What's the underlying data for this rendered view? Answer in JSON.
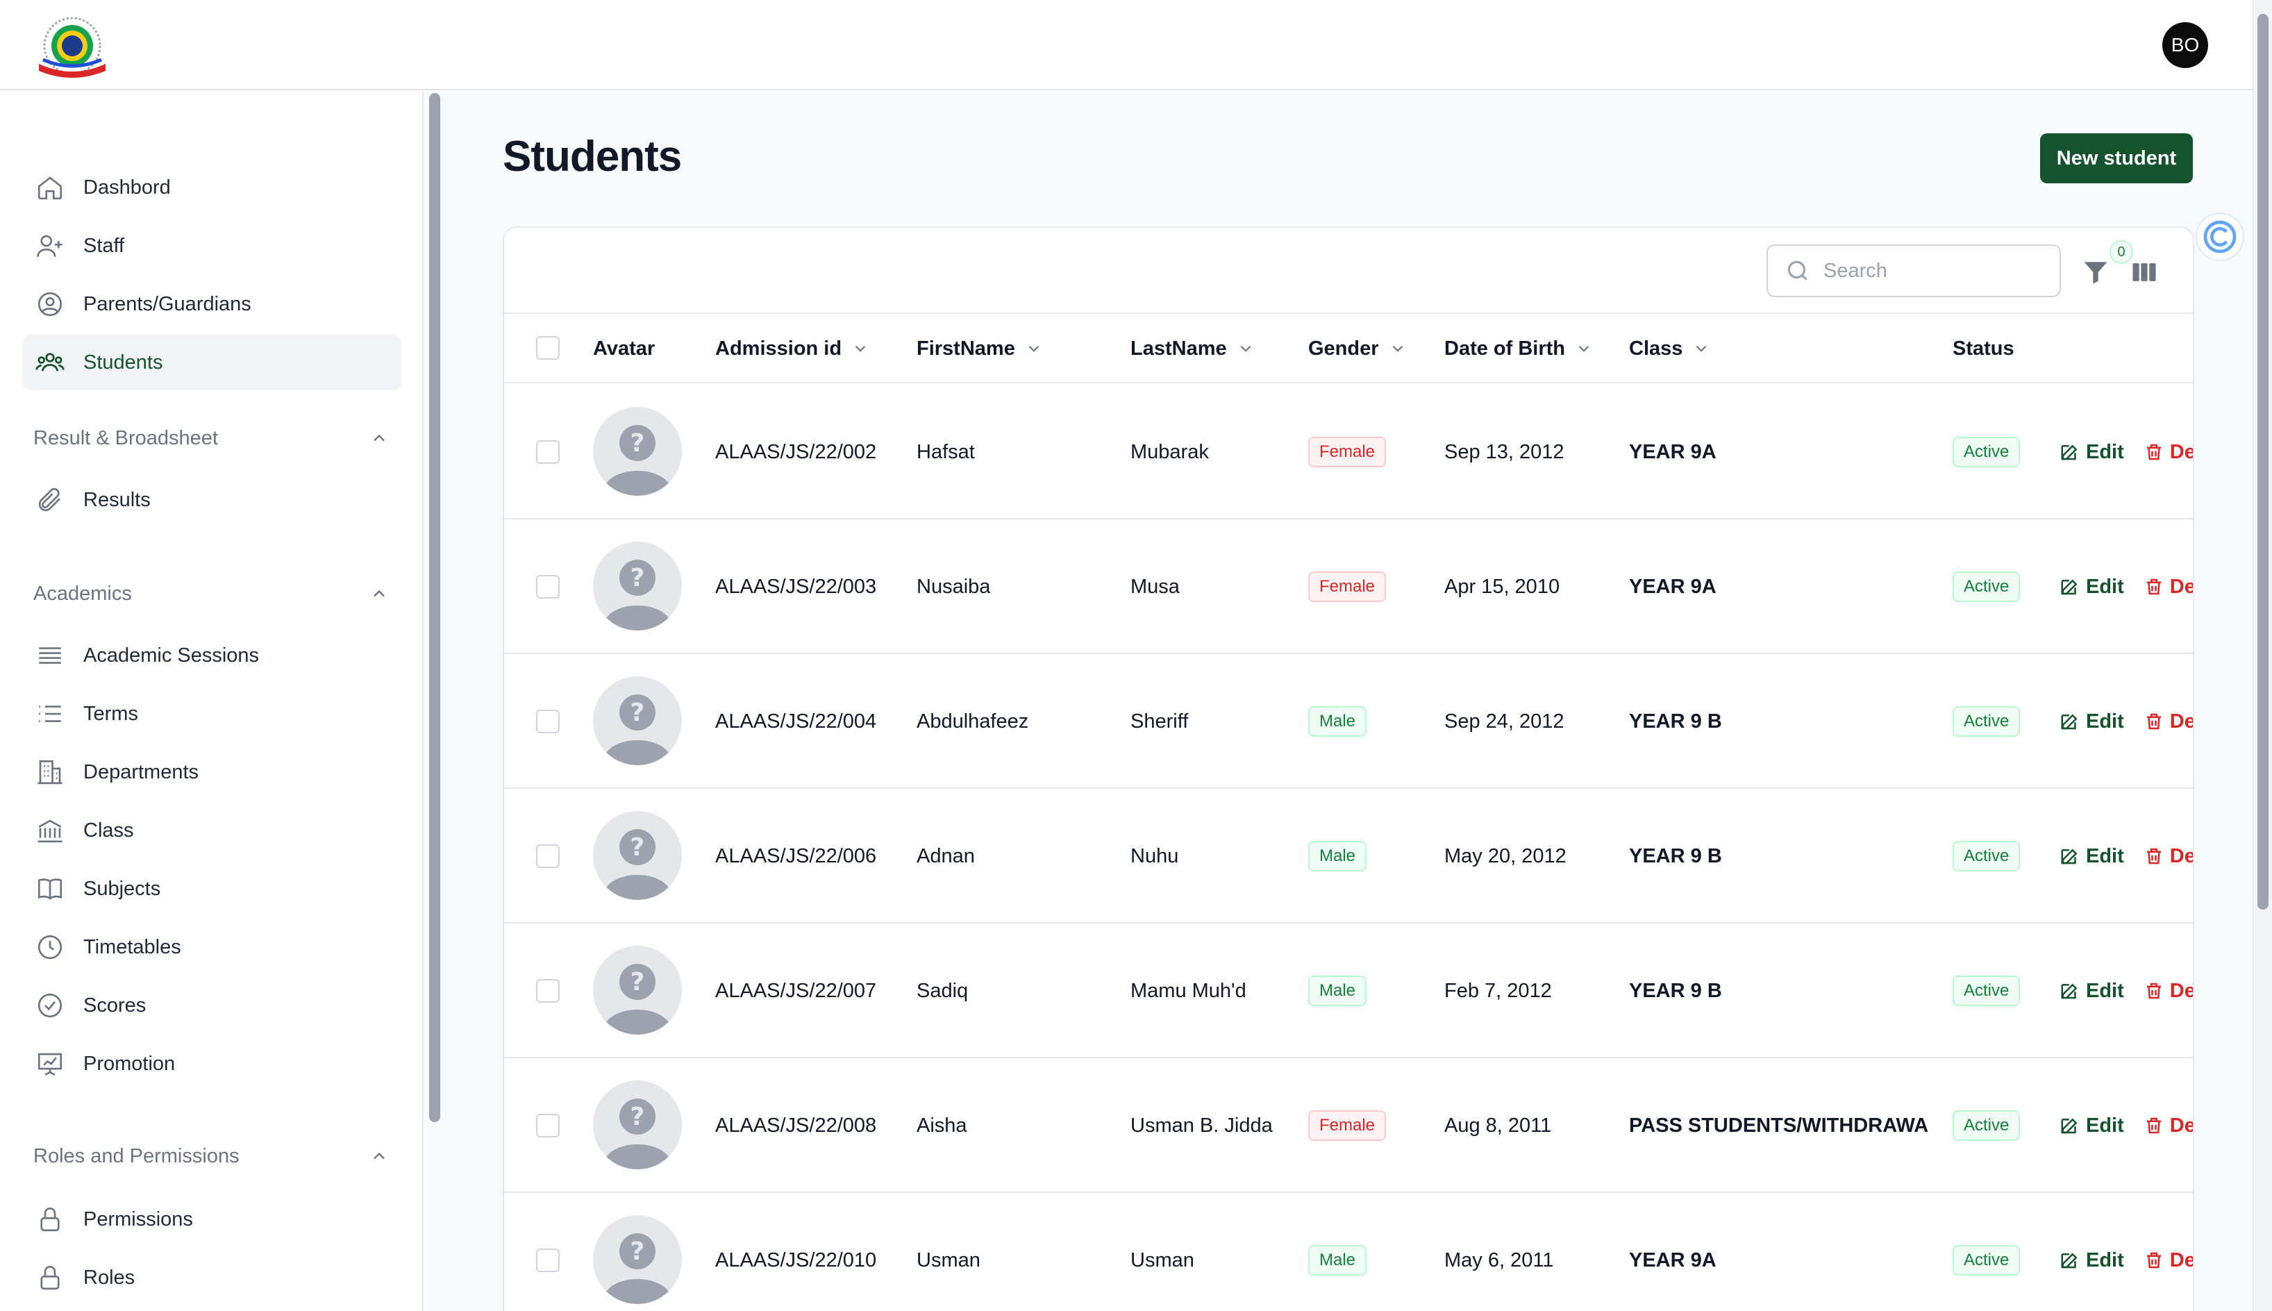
{
  "header": {
    "user_initials": "BO"
  },
  "sidebar": {
    "items_top": [
      {
        "label": "Dashbord",
        "icon": "home-icon"
      },
      {
        "label": "Staff",
        "icon": "user-plus-icon"
      },
      {
        "label": "Parents/Guardians",
        "icon": "user-circle-icon"
      },
      {
        "label": "Students",
        "icon": "users-group-icon",
        "active": true
      }
    ],
    "groups": [
      {
        "label": "Result & Broadsheet",
        "items": [
          {
            "label": "Results",
            "icon": "paperclip-icon"
          }
        ]
      },
      {
        "label": "Academics",
        "items": [
          {
            "label": "Academic Sessions",
            "icon": "stack-icon"
          },
          {
            "label": "Terms",
            "icon": "list-icon"
          },
          {
            "label": "Departments",
            "icon": "building-icon"
          },
          {
            "label": "Class",
            "icon": "bank-icon"
          },
          {
            "label": "Subjects",
            "icon": "book-icon"
          },
          {
            "label": "Timetables",
            "icon": "clock-icon"
          },
          {
            "label": "Scores",
            "icon": "check-badge-icon"
          },
          {
            "label": "Promotion",
            "icon": "chart-board-icon"
          }
        ]
      },
      {
        "label": "Roles and Permissions",
        "items": [
          {
            "label": "Permissions",
            "icon": "lock-icon"
          },
          {
            "label": "Roles",
            "icon": "lock-icon"
          }
        ]
      }
    ]
  },
  "main": {
    "title": "Students",
    "new_button": "New student",
    "search_placeholder": "Search",
    "filter_count": "0"
  },
  "table": {
    "columns": [
      "Avatar",
      "Admission id",
      "FirstName",
      "LastName",
      "Gender",
      "Date of Birth",
      "Class",
      "Status"
    ],
    "edit_label": "Edit",
    "delete_label": "De",
    "rows": [
      {
        "admission_id": "ALAAS/JS/22/002",
        "first": "Hafsat",
        "last": "Mubarak",
        "gender": "Female",
        "dob": "Sep 13, 2012",
        "class": "YEAR 9A",
        "status": "Active"
      },
      {
        "admission_id": "ALAAS/JS/22/003",
        "first": "Nusaiba",
        "last": "Musa",
        "gender": "Female",
        "dob": "Apr 15, 2010",
        "class": "YEAR 9A",
        "status": "Active"
      },
      {
        "admission_id": "ALAAS/JS/22/004",
        "first": "Abdulhafeez",
        "last": "Sheriff",
        "gender": "Male",
        "dob": "Sep 24, 2012",
        "class": "YEAR 9 B",
        "status": "Active"
      },
      {
        "admission_id": "ALAAS/JS/22/006",
        "first": "Adnan",
        "last": "Nuhu",
        "gender": "Male",
        "dob": "May 20, 2012",
        "class": "YEAR 9 B",
        "status": "Active"
      },
      {
        "admission_id": "ALAAS/JS/22/007",
        "first": "Sadiq",
        "last": "Mamu Muh'd",
        "gender": "Male",
        "dob": "Feb 7, 2012",
        "class": "YEAR 9 B",
        "status": "Active"
      },
      {
        "admission_id": "ALAAS/JS/22/008",
        "first": "Aisha",
        "last": "Usman B. Jidda",
        "gender": "Female",
        "dob": "Aug 8, 2011",
        "class": "PASS STUDENTS/WITHDRAWA",
        "status": "Active"
      },
      {
        "admission_id": "ALAAS/JS/22/010",
        "first": "Usman",
        "last": "Usman",
        "gender": "Male",
        "dob": "May 6, 2011",
        "class": "YEAR 9A",
        "status": "Active"
      }
    ]
  },
  "colors": {
    "brand": "#14532d",
    "female": "#dc2626",
    "male": "#15803d"
  }
}
